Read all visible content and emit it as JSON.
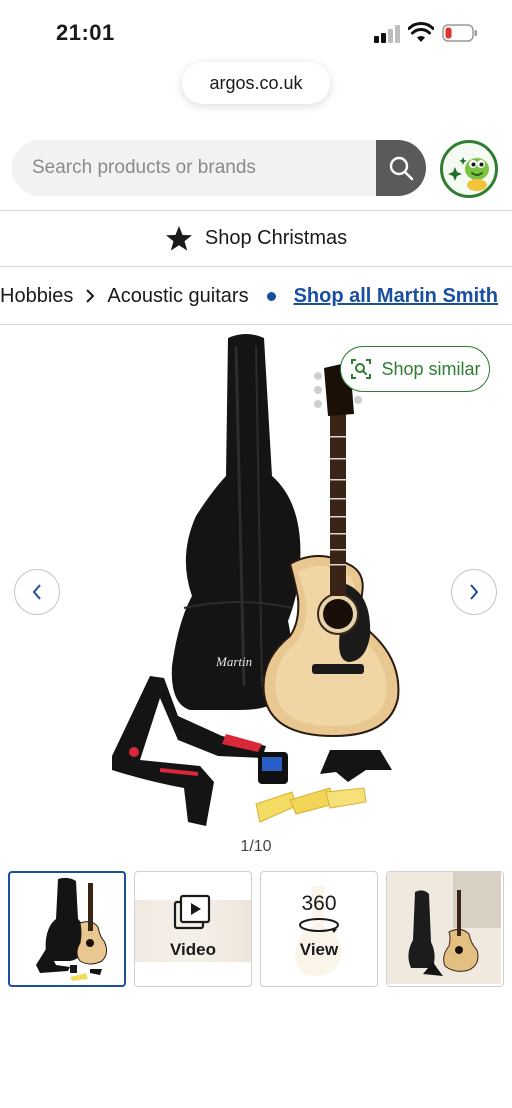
{
  "status_bar": {
    "time": "21:01"
  },
  "browser": {
    "url": "argos.co.uk"
  },
  "search": {
    "placeholder": "Search products or brands"
  },
  "promo": {
    "label": "Shop Christmas"
  },
  "breadcrumb": {
    "items": [
      "Hobbies",
      "Acoustic guitars"
    ],
    "shop_all_link": "Shop all Martin Smith"
  },
  "gallery": {
    "shop_similar_label": "Shop similar",
    "counter": "1/10",
    "brand_mark": "Martin",
    "thumbnails": [
      {
        "kind": "image",
        "label": ""
      },
      {
        "kind": "video",
        "label": "Video"
      },
      {
        "kind": "360",
        "label_top": "360",
        "label": "View"
      },
      {
        "kind": "image",
        "label": ""
      }
    ]
  },
  "colors": {
    "accent_green": "#2f7d32",
    "link_blue": "#1a4fa0",
    "search_button": "#5a5a5a",
    "battery_low": "#e0332f"
  },
  "icons": [
    "signal-icon",
    "wifi-icon",
    "battery-icon",
    "search-icon",
    "ai-assistant-icon",
    "star-icon",
    "chevron-right-icon",
    "visual-search-icon",
    "chevron-left-icon",
    "video-icon",
    "rotate-360-icon"
  ]
}
